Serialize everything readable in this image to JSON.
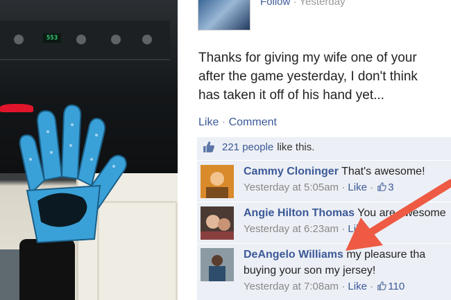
{
  "post": {
    "follow_label": "Follow",
    "separator": " · ",
    "time": "Yesterday",
    "text": "Thanks for giving my wife one of your\nafter the game yesterday, I don't think\nhas taken it off of his hand yet...",
    "like_label": "Like",
    "comment_label": "Comment",
    "likes_count": "221 people",
    "likes_suffix": "like this."
  },
  "photo": {
    "stove_display": "553"
  },
  "comments": [
    {
      "name": "Cammy Cloninger",
      "text": " That's awesome!",
      "time": "Yesterday at 5:05am",
      "like_label": "Like",
      "like_count": "3"
    },
    {
      "name": "Angie Hilton Thomas",
      "text": " You are awesome",
      "time": "Yesterday at 6:23am",
      "like_label": "Like"
    },
    {
      "name": "DeAngelo Williams",
      "text": " my pleasure tha",
      "text_line2": "buying your son my jersey!",
      "time": "Yesterday at 7:08am",
      "like_label": "Like",
      "like_count": "110"
    }
  ],
  "colors": {
    "link": "#3b5998",
    "likes_background": "#eceff5",
    "arrow": "#ee5a43"
  }
}
